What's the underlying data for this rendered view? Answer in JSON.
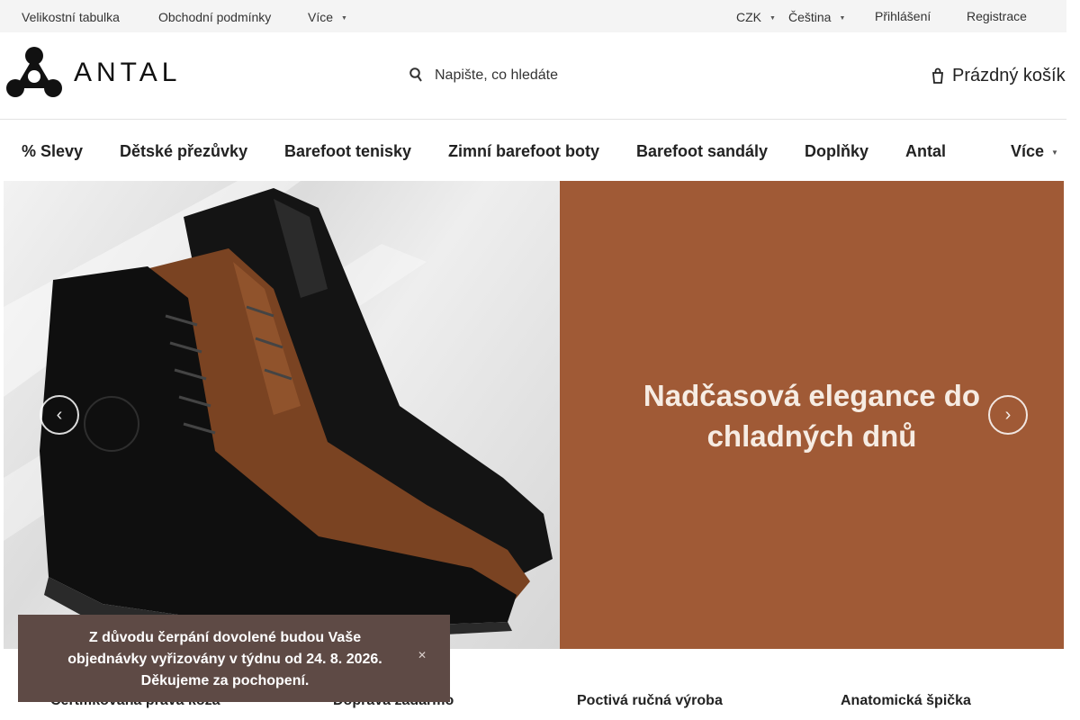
{
  "topbar": {
    "links": [
      "Velikostní tabulka",
      "Obchodní podmínky",
      "Více"
    ],
    "currency": "CZK",
    "language": "Čeština",
    "login": "Přihlášení",
    "register": "Registrace"
  },
  "header": {
    "brand": "ANTAL",
    "search_placeholder": "Napište, co hledáte",
    "cart_label": "Prázdný košík"
  },
  "nav": {
    "items": [
      "% Slevy",
      "Dětské přezůvky",
      "Barefoot tenisky",
      "Zimní barefoot boty",
      "Barefoot sandály",
      "Doplňky",
      "Antal"
    ],
    "more": "Více"
  },
  "hero": {
    "title_line1": "Nadčasová elegance do",
    "title_line2": "chladných dnů",
    "background_color": "#a05a36"
  },
  "benefits": [
    "Certifikovaná pravá koža",
    "Doprava zadarmo",
    "Poctivá ručná výroba",
    "Anatomická špička"
  ],
  "notice": {
    "text": "Z důvodu čerpání dovolené budou Vaše objednávky vyřizovány v týdnu od 24. 8. 2026. Děkujeme za pochopení.",
    "color": "#5e4a45"
  },
  "icons": {
    "search": "search-icon",
    "cart": "cart-icon",
    "prev": "chevron-left-icon",
    "next": "chevron-right-icon",
    "close": "close-icon"
  }
}
